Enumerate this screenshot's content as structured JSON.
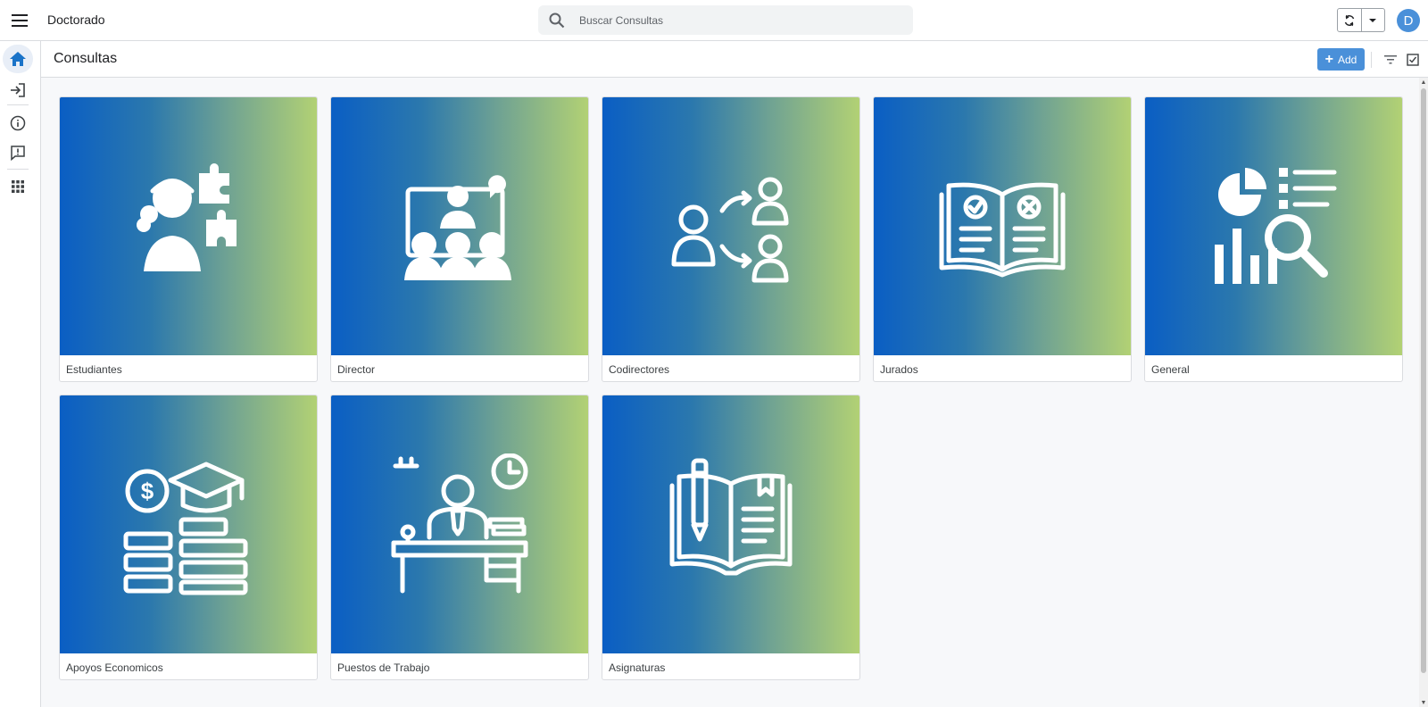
{
  "header": {
    "app_title": "Doctorado",
    "search_placeholder": "Buscar Consultas",
    "avatar_initial": "D"
  },
  "page": {
    "title": "Consultas",
    "add_label": "Add"
  },
  "cards": [
    {
      "label": "Estudiantes",
      "icon": "student-puzzle-icon"
    },
    {
      "label": "Director",
      "icon": "presenter-audience-icon"
    },
    {
      "label": "Codirectores",
      "icon": "people-arrows-icon"
    },
    {
      "label": "Jurados",
      "icon": "open-book-check-cross-icon"
    },
    {
      "label": "General",
      "icon": "analytics-search-icon"
    },
    {
      "label": "Apoyos Economicos",
      "icon": "money-graduation-cap-icon"
    },
    {
      "label": "Puestos de Trabajo",
      "icon": "desk-worker-clock-icon"
    },
    {
      "label": "Asignaturas",
      "icon": "book-pencil-icon"
    }
  ],
  "colors": {
    "accent": "#4a90d9",
    "gradient_start": "#0a5ec4",
    "gradient_end": "#b2d174"
  }
}
